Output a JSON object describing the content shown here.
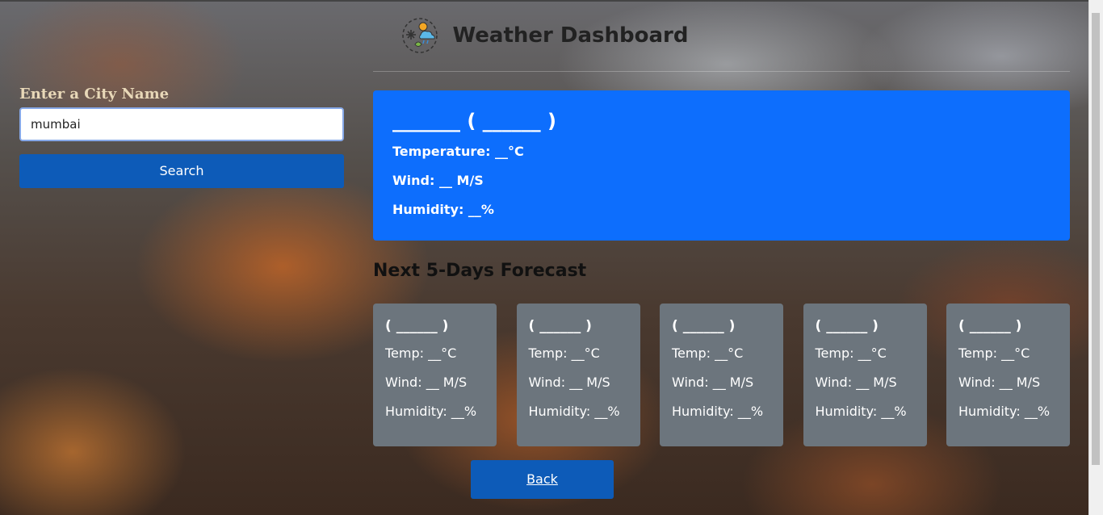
{
  "header": {
    "title": "Weather Dashboard",
    "logo_icon": "weather-logo-icon"
  },
  "search": {
    "label": "Enter a City Name",
    "input_value": "mumbai",
    "button_label": "Search"
  },
  "current": {
    "title": "_______ ( ______ )",
    "temperature": "Temperature: __°C",
    "wind": "Wind: __ M/S",
    "humidity": "Humidity: __%"
  },
  "forecast": {
    "heading": "Next 5-Days Forecast",
    "days": [
      {
        "date": "( ______ )",
        "temp": "Temp: __°C",
        "wind": "Wind: __ M/S",
        "humidity": "Humidity: __%"
      },
      {
        "date": "( ______ )",
        "temp": "Temp: __°C",
        "wind": "Wind: __ M/S",
        "humidity": "Humidity: __%"
      },
      {
        "date": "( ______ )",
        "temp": "Temp: __°C",
        "wind": "Wind: __ M/S",
        "humidity": "Humidity: __%"
      },
      {
        "date": "( ______ )",
        "temp": "Temp: __°C",
        "wind": "Wind: __ M/S",
        "humidity": "Humidity: __%"
      },
      {
        "date": "( ______ )",
        "temp": "Temp: __°C",
        "wind": "Wind: __ M/S",
        "humidity": "Humidity: __%"
      }
    ]
  },
  "back": {
    "label": "Back"
  },
  "colors": {
    "current_bg": "#0d6efd",
    "card_bg": "#6c757d",
    "button_bg": "#0d5bb8"
  }
}
